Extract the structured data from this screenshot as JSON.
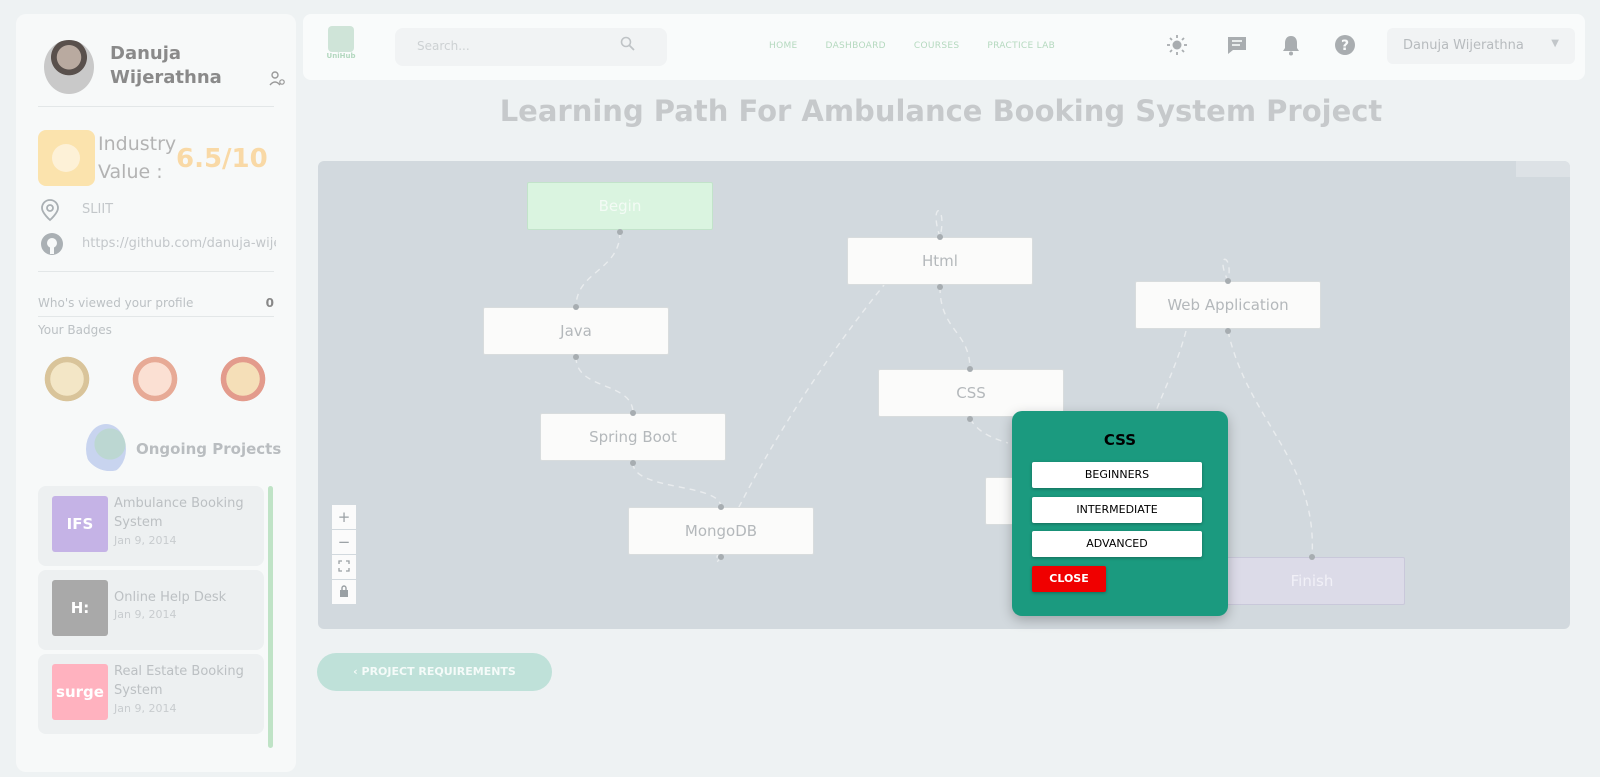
{
  "profile": {
    "name": "Danuja Wijerathna"
  },
  "industry": {
    "label": "Industry Value :",
    "value": "6.5/10"
  },
  "info": {
    "location": "SLIIT",
    "github": "https://github.com/danuja-wijerathna"
  },
  "stats": {
    "viewed_label": "Who's viewed your profile",
    "viewed_count": "0",
    "badges_title": "Your Badges"
  },
  "ongoing": {
    "title": "Ongoing Projects",
    "projects": [
      {
        "title": "Ambulance Booking System",
        "date": "Jan 9, 2014",
        "thumb": "IFS",
        "thumb_color": "#c5b3e6"
      },
      {
        "title": "Online Help Desk",
        "date": "Jan 9, 2014",
        "thumb": "H:",
        "thumb_color": "#a9a9a9"
      },
      {
        "title": "Real Estate Booking System",
        "date": "Jan 9, 2014",
        "thumb": "surge",
        "thumb_color": "#ffb2bf"
      }
    ]
  },
  "header": {
    "logo_text": "UniHub",
    "search_placeholder": "Search...",
    "nav": [
      "HOME",
      "DASHBOARD",
      "COURSES",
      "PRACTICE LAB"
    ],
    "user": "Danuja Wijerathna"
  },
  "page": {
    "title": "Learning Path For Ambulance Booking System Project"
  },
  "flow": {
    "nodes": {
      "begin": "Begin",
      "java": "Java",
      "spring": "Spring Boot",
      "mongodb": "MongoDB",
      "html": "Html",
      "css": "CSS",
      "webapp": "Web Application",
      "finish": "Finish"
    }
  },
  "back_button": "PROJECT REQUIREMENTS",
  "modal": {
    "title": "CSS",
    "levels": [
      "BEGINNERS",
      "INTERMEDIATE",
      "ADVANCED"
    ],
    "close": "CLOSE"
  },
  "colors": {
    "accent": "#1b9a7f",
    "close": "#f00000",
    "begin": "#daf4e0",
    "finish": "#dcdbe8"
  }
}
